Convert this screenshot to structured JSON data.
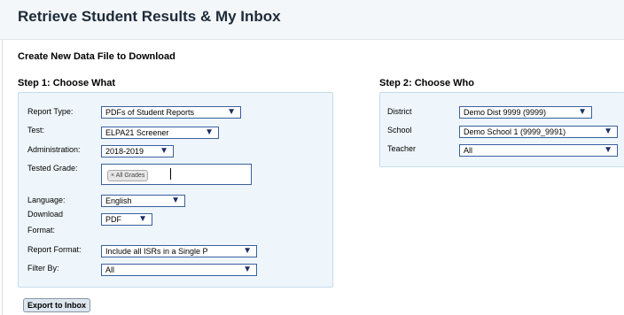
{
  "header": {
    "title": "Retrieve Student Results & My Inbox"
  },
  "section": {
    "title": "Create New Data File to Download"
  },
  "step1": {
    "title": "Step 1: Choose What",
    "report_type": {
      "label": "Report Type:",
      "value": "PDFs of Student Reports"
    },
    "test": {
      "label": "Test:",
      "value": "ELPA21 Screener"
    },
    "administration": {
      "label": "Administration:",
      "value": "2018-2019"
    },
    "tested_grade": {
      "label": "Tested Grade:",
      "tag": "× All Grades"
    },
    "language": {
      "label": "Language:",
      "value": "English"
    },
    "download_format": {
      "label_line1": "Download",
      "label_line2": "Format:",
      "value": "PDF"
    },
    "report_format": {
      "label": "Report Format:",
      "value": "Include all ISRs in a Single P"
    },
    "filter_by": {
      "label": "Filter By:",
      "value": "All"
    }
  },
  "step2": {
    "title": "Step 2: Choose Who",
    "district": {
      "label": "District",
      "value": "Demo Dist 9999 (9999)"
    },
    "school": {
      "label": "School",
      "value": "Demo School 1 (9999_9991)"
    },
    "teacher": {
      "label": "Teacher",
      "value": "All"
    }
  },
  "actions": {
    "export_label": "Export to Inbox"
  },
  "icons": {
    "dropdown": "▼"
  },
  "colors": {
    "panel_bg": "#eef6fb",
    "panel_border": "#c4dcec",
    "select_border": "#3a5fa0",
    "title": "#1d2b3a"
  }
}
